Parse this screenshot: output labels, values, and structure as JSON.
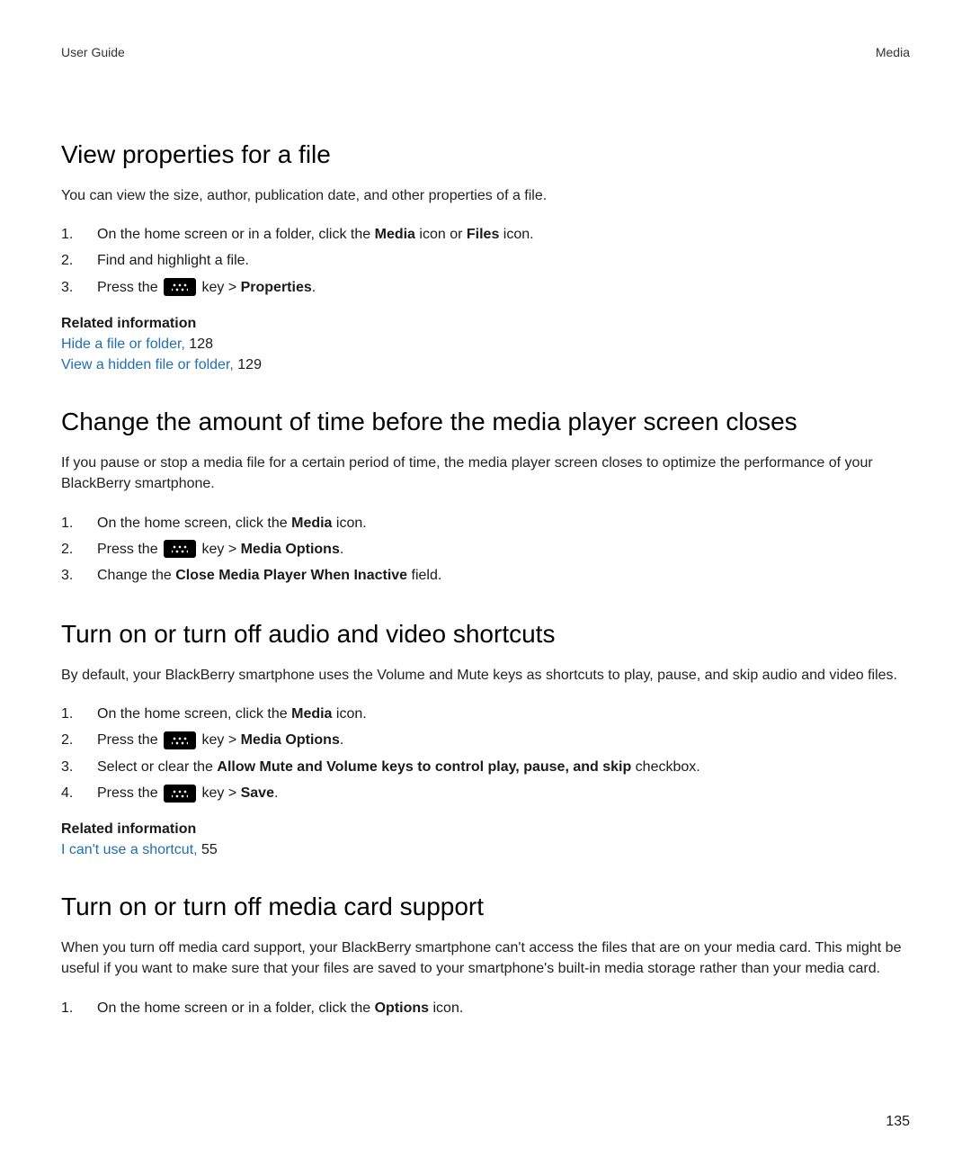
{
  "header": {
    "left": "User Guide",
    "right": "Media"
  },
  "section1": {
    "heading": "View properties for a file",
    "intro": "You can view the size, author, publication date, and other properties of a file.",
    "step1_a": "On the home screen or in a folder, click the ",
    "step1_b": "Media",
    "step1_c": " icon or ",
    "step1_d": "Files",
    "step1_e": " icon.",
    "step2": "Find and highlight a file.",
    "step3_a": "Press the ",
    "step3_b": " key > ",
    "step3_c": "Properties",
    "step3_d": ".",
    "related_heading": "Related information",
    "link1": "Hide a file or folder,",
    "link1_page": " 128",
    "link2": "View a hidden file or folder,",
    "link2_page": " 129"
  },
  "section2": {
    "heading": "Change the amount of time before the media player screen closes",
    "intro": "If you pause or stop a media file for a certain period of time, the media player screen closes to optimize the performance of your BlackBerry smartphone.",
    "step1_a": "On the home screen, click the ",
    "step1_b": "Media",
    "step1_c": " icon.",
    "step2_a": "Press the ",
    "step2_b": " key > ",
    "step2_c": "Media Options",
    "step2_d": ".",
    "step3_a": "Change the ",
    "step3_b": "Close Media Player When Inactive",
    "step3_c": " field."
  },
  "section3": {
    "heading": "Turn on or turn off audio and video shortcuts",
    "intro": "By default, your BlackBerry smartphone uses the Volume and Mute keys as shortcuts to play, pause, and skip audio and video files.",
    "step1_a": "On the home screen, click the ",
    "step1_b": "Media",
    "step1_c": " icon.",
    "step2_a": "Press the ",
    "step2_b": " key > ",
    "step2_c": "Media Options",
    "step2_d": ".",
    "step3_a": "Select or clear the ",
    "step3_b": "Allow Mute and Volume keys to control play, pause, and skip",
    "step3_c": " checkbox.",
    "step4_a": "Press the ",
    "step4_b": " key > ",
    "step4_c": "Save",
    "step4_d": ".",
    "related_heading": "Related information",
    "link1": "I can't use a shortcut,",
    "link1_page": " 55"
  },
  "section4": {
    "heading": "Turn on or turn off media card support",
    "intro": "When you turn off media card support, your BlackBerry smartphone can't access the files that are on your media card. This might be useful if you want to make sure that your files are saved to your smartphone's built-in media storage rather than your media card.",
    "step1_a": "On the home screen or in a folder, click the ",
    "step1_b": "Options",
    "step1_c": " icon."
  },
  "page_number": "135"
}
